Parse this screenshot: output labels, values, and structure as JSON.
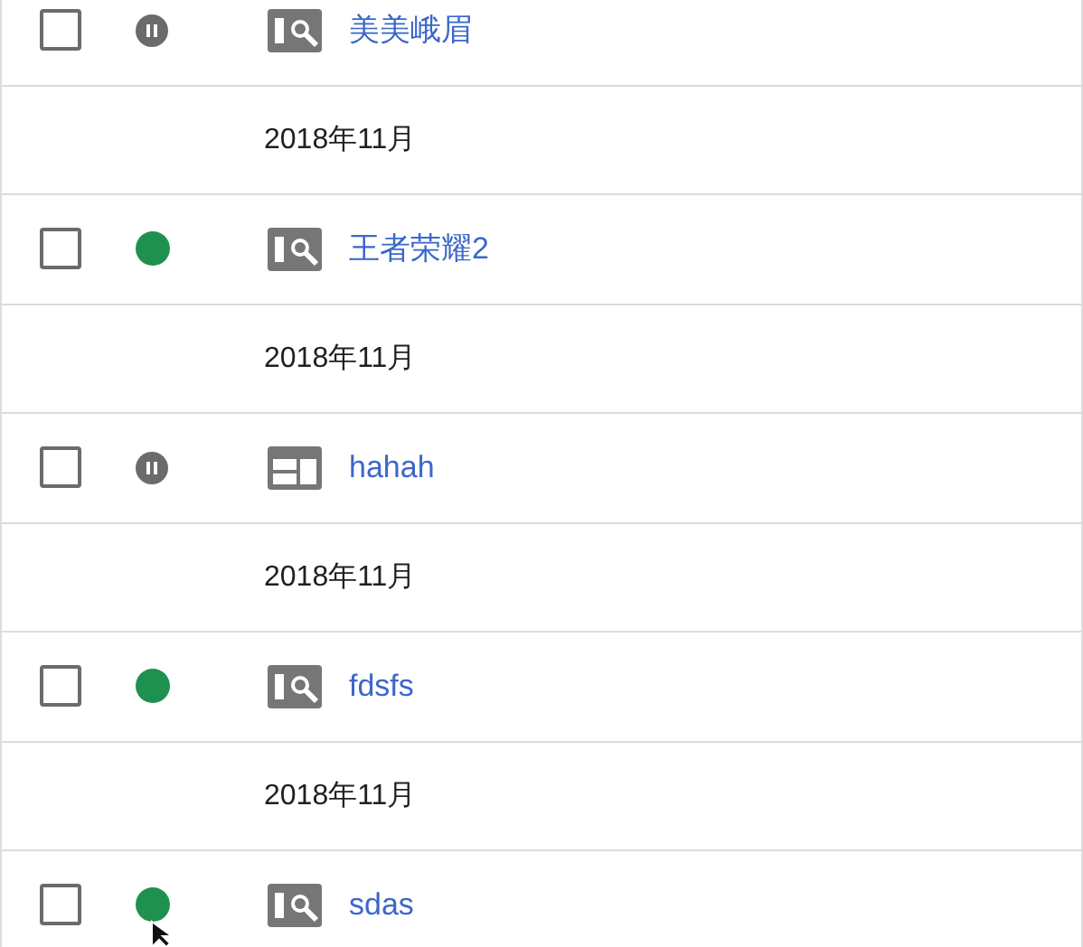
{
  "rows": [
    {
      "kind": "search",
      "checked": false,
      "paused": true,
      "name": "美美峨眉"
    },
    {
      "kind": "date",
      "label": "2018年11月"
    },
    {
      "kind": "search",
      "checked": false,
      "paused": false,
      "name": "王者荣耀2"
    },
    {
      "kind": "date",
      "label": "2018年11月"
    },
    {
      "kind": "display",
      "checked": false,
      "paused": true,
      "name": "hahah"
    },
    {
      "kind": "date",
      "label": "2018年11月"
    },
    {
      "kind": "search",
      "checked": false,
      "paused": false,
      "name": "fdsfs"
    },
    {
      "kind": "date",
      "label": "2018年11月"
    },
    {
      "kind": "search",
      "checked": false,
      "paused": false,
      "name": "sdas"
    }
  ]
}
